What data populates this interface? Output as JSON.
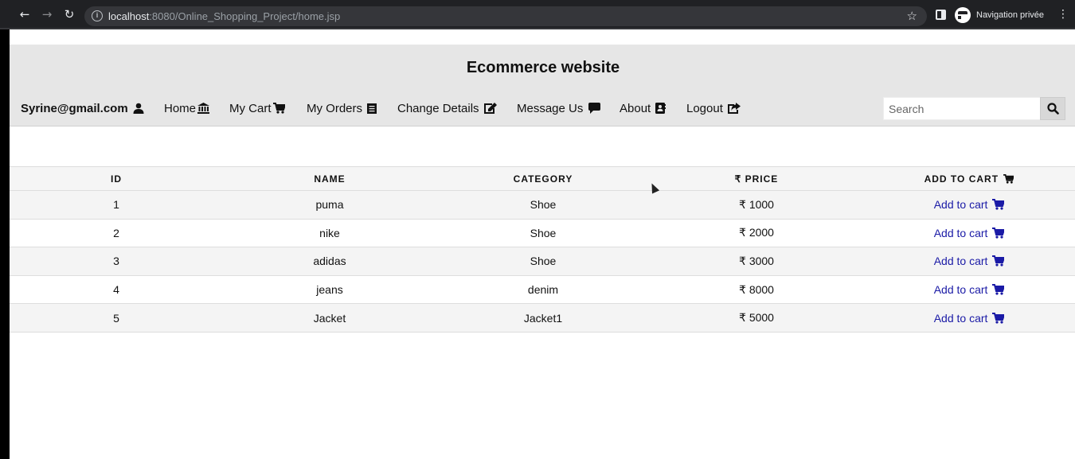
{
  "browser": {
    "url_host": "localhost",
    "url_rest": ":8080/Online_Shopping_Project/home.jsp",
    "incognito_label": "Navigation privée"
  },
  "site": {
    "title": "Ecommerce website"
  },
  "nav": {
    "user": "Syrine@gmail.com",
    "items": [
      {
        "label": "Home",
        "icon": "bank-icon"
      },
      {
        "label": "My Cart",
        "icon": "cart-icon"
      },
      {
        "label": "My Orders",
        "icon": "list-icon"
      },
      {
        "label": "Change Details",
        "icon": "edit-icon"
      },
      {
        "label": "Message Us",
        "icon": "comment-icon"
      },
      {
        "label": "About",
        "icon": "address-book-icon"
      },
      {
        "label": "Logout",
        "icon": "share-icon"
      }
    ]
  },
  "search": {
    "placeholder": "Search"
  },
  "table": {
    "headers": [
      "ID",
      "NAME",
      "CATEGORY",
      "PRICE",
      "ADD TO CART"
    ],
    "currency_symbol": "₹",
    "rows": [
      {
        "id": "1",
        "name": "puma",
        "category": "Shoe",
        "price": "1000",
        "action": "Add to cart"
      },
      {
        "id": "2",
        "name": "nike",
        "category": "Shoe",
        "price": "2000",
        "action": "Add to cart"
      },
      {
        "id": "3",
        "name": "adidas",
        "category": "Shoe",
        "price": "3000",
        "action": "Add to cart"
      },
      {
        "id": "4",
        "name": "jeans",
        "category": "denim",
        "price": "8000",
        "action": "Add to cart"
      },
      {
        "id": "5",
        "name": "Jacket",
        "category": "Jacket1",
        "price": "5000",
        "action": "Add to cart"
      }
    ]
  },
  "colors": {
    "header_bg": "#e6e6e6",
    "link": "#1a1aa6",
    "chrome_bg": "#202124"
  }
}
